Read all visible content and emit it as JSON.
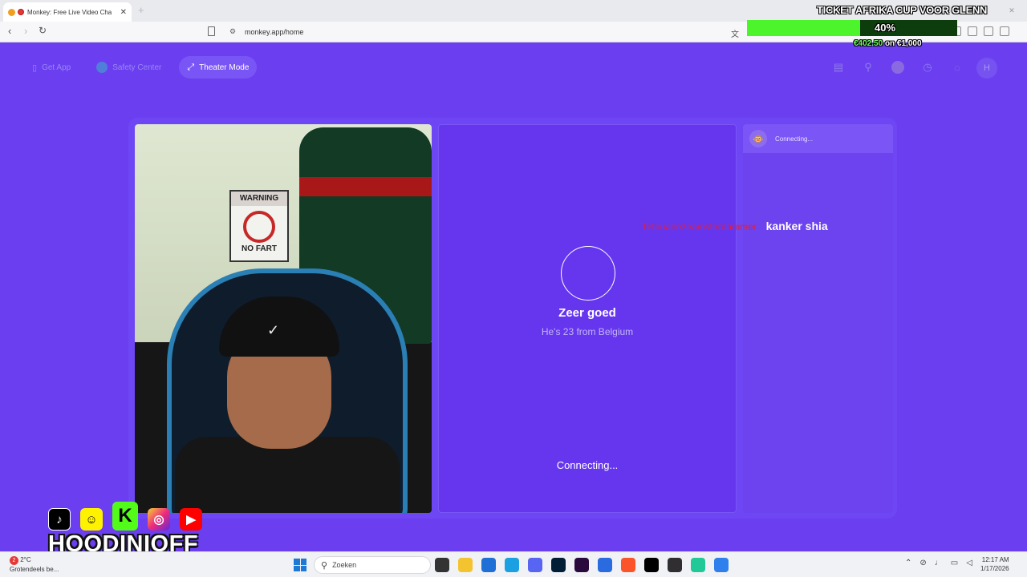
{
  "browser": {
    "tab_title": "Monkey: Free Live Video Cha",
    "tab_close": "✕",
    "new_tab": "+",
    "url": "monkey.app/home",
    "window_controls": [
      "—",
      "❐",
      "✕"
    ]
  },
  "overlay": {
    "goal_title": "TICKET AFRIKA CUP VOOR GLENN",
    "goal_percent_label": "40%",
    "goal_progress": 0.54,
    "goal_current": "€402.50",
    "goal_of": "on €1,000",
    "social_icons": [
      "tiktok-icon",
      "snapchat-icon",
      "kick-icon",
      "instagram-icon",
      "youtube-icon"
    ],
    "handle": "HOODINIOFF"
  },
  "nav": {
    "get_app": "Get App",
    "safety_center": "Safety Center",
    "theater_mode": "Theater Mode",
    "avatar_initial": "H"
  },
  "match": {
    "name": "Zeer goed",
    "subtitle": "He's 23 from Belgium",
    "status": "Connecting..."
  },
  "chat": {
    "header_status": "Connecting...",
    "message_user": "Tetouanezeamsterdammer",
    "message_text": "kanker shia"
  },
  "video": {
    "sign_title": "WARNING",
    "sign_text": "NO FART"
  },
  "taskbar": {
    "weather_badge": "2",
    "weather_temp": "2°C",
    "weather_text": "Grotendeels be...",
    "search_placeholder": "Zoeken",
    "time": "12:17 AM",
    "date": "1/17/2026"
  },
  "colors": {
    "page_bg": "#6b3ff0",
    "goal_fill": "#4cf52b",
    "chat_username": "#d6204a"
  }
}
